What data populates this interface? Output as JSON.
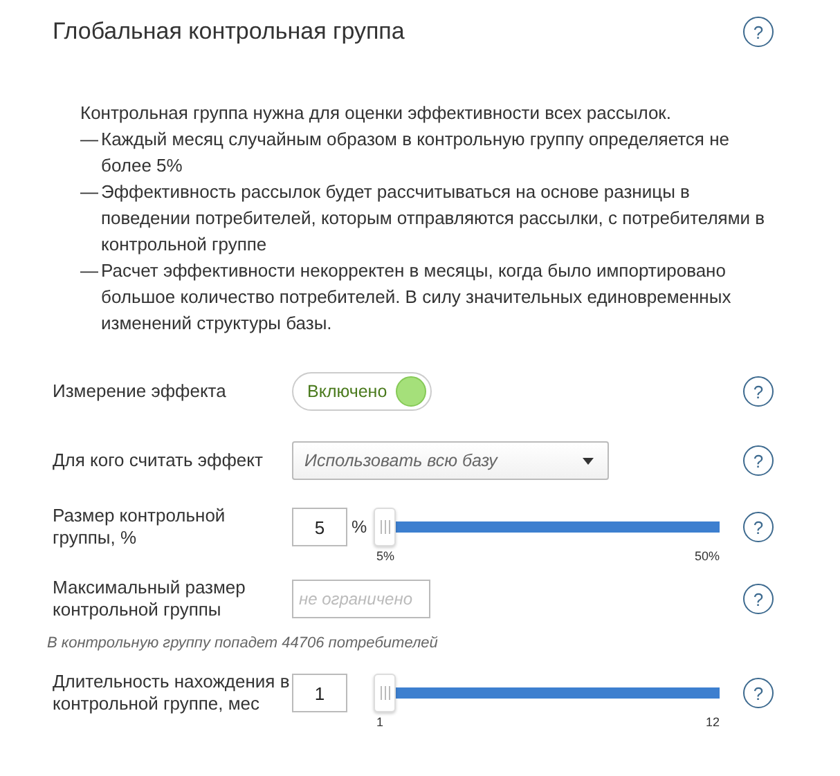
{
  "title": "Глобальная контрольная группа",
  "help": "?",
  "description": {
    "intro": "Контрольная группа нужна для оценки эффективности всех рассылок.",
    "bullet": "—",
    "points": [
      "Каждый месяц случайным образом в контрольную группу определяется не более 5%",
      "Эффективность рассылок будет рассчитываться на основе разницы в поведении потребителей, которым отправляются рассылки, с потребителями в контрольной группе",
      "Расчет эффективности некорректен в месяцы, когда было импортировано большое количество потребителей. В силу значительных единовременных изменений структуры базы."
    ]
  },
  "rows": [
    {
      "kind": "toggle",
      "label": "Измерение эффекта",
      "value": "Включено",
      "on": true,
      "help": "?"
    },
    {
      "kind": "select",
      "label": "Для кого считать эффект",
      "value": "Использовать всю базу",
      "help": "?"
    },
    {
      "kind": "slider",
      "label": "Размер контрольной группы, %",
      "value": "5",
      "unit": "%",
      "level": 0,
      "min": "5%",
      "max": "50%",
      "help": "?"
    },
    {
      "kind": "input",
      "label": "Максимальный размер контрольной группы",
      "placeholder": "не ограничено",
      "help": "?"
    },
    {
      "kind": "note",
      "text": "В контрольную группу попадет 44706 потребителей"
    },
    {
      "kind": "slider",
      "label": "Длительность нахождения в контрольной группе, мес",
      "value": "1",
      "level": 0,
      "min": "1",
      "max": "12",
      "help": "?"
    }
  ]
}
